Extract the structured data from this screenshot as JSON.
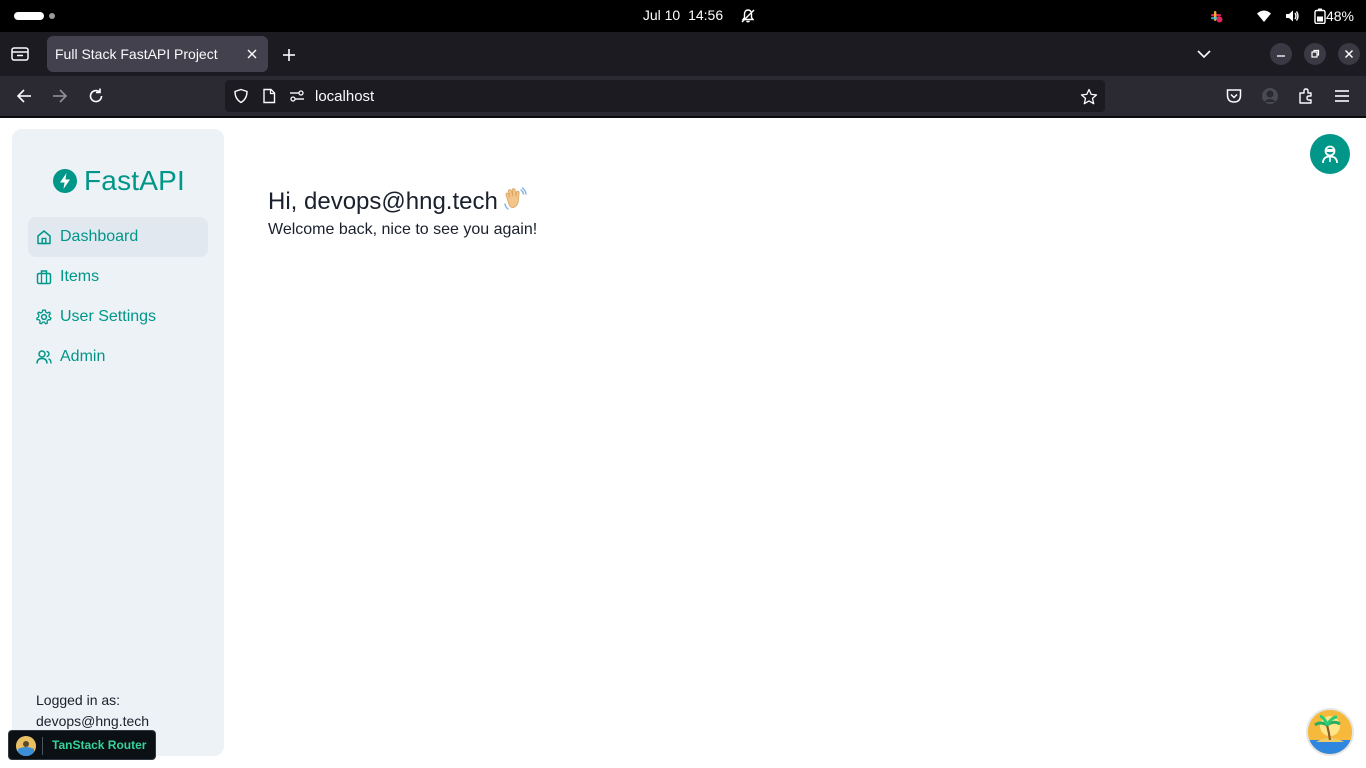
{
  "system_bar": {
    "date": "Jul 10",
    "time": "14:56",
    "battery_percent": "48%"
  },
  "browser": {
    "tab_title": "Full Stack FastAPI Project",
    "url": "localhost"
  },
  "sidebar": {
    "logo_text": "FastAPI",
    "items": [
      {
        "label": "Dashboard",
        "icon": "home-icon",
        "active": true
      },
      {
        "label": "Items",
        "icon": "briefcase-icon",
        "active": false
      },
      {
        "label": "User Settings",
        "icon": "gear-icon",
        "active": false
      },
      {
        "label": "Admin",
        "icon": "users-icon",
        "active": false
      }
    ],
    "logged_in_label": "Logged in as:",
    "logged_in_email": "devops@hng.tech"
  },
  "main": {
    "greeting": "Hi, devops@hng.tech",
    "greeting_emoji": "waving-hand",
    "subtitle": "Welcome back, nice to see you again!"
  },
  "devtools": {
    "label": "TanStack Router"
  },
  "colors": {
    "accent": "#009688",
    "sidebar_bg": "#edf2f7",
    "active_item_bg": "#e2e8f0",
    "browser_chrome": "#2b2a33"
  }
}
